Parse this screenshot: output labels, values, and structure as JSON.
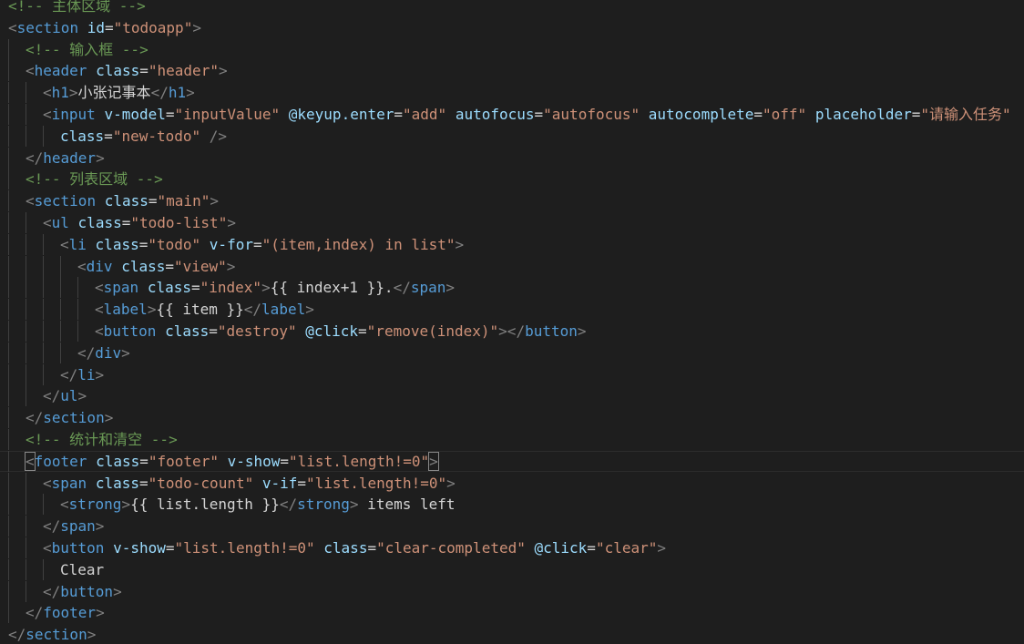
{
  "editor": {
    "theme": {
      "background": "#1e1e1e",
      "comment": "#6a9955",
      "tag": "#569cd6",
      "attribute": "#9cdcfe",
      "string": "#ce9178",
      "text": "#d4d4d4",
      "bracket": "#808080"
    },
    "current_line": 21,
    "lines": [
      {
        "indent": 0,
        "tokens": [
          [
            "cmt",
            "<!-- 主体区域 -->"
          ]
        ]
      },
      {
        "indent": 0,
        "tokens": [
          [
            "br",
            "<"
          ],
          [
            "tag",
            "section"
          ],
          [
            "txt",
            " "
          ],
          [
            "attr",
            "id"
          ],
          [
            "eq",
            "="
          ],
          [
            "str",
            "\"todoapp\""
          ],
          [
            "br",
            ">"
          ]
        ]
      },
      {
        "indent": 1,
        "tokens": [
          [
            "cmt",
            "<!-- 输入框 -->"
          ]
        ]
      },
      {
        "indent": 1,
        "tokens": [
          [
            "br",
            "<"
          ],
          [
            "tag",
            "header"
          ],
          [
            "txt",
            " "
          ],
          [
            "attr",
            "class"
          ],
          [
            "eq",
            "="
          ],
          [
            "str",
            "\"header\""
          ],
          [
            "br",
            ">"
          ]
        ]
      },
      {
        "indent": 2,
        "tokens": [
          [
            "br",
            "<"
          ],
          [
            "tag",
            "h1"
          ],
          [
            "br",
            ">"
          ],
          [
            "txt",
            "小张记事本"
          ],
          [
            "br",
            "</"
          ],
          [
            "tag",
            "h1"
          ],
          [
            "br",
            ">"
          ]
        ]
      },
      {
        "indent": 2,
        "tokens": [
          [
            "br",
            "<"
          ],
          [
            "tag",
            "input"
          ],
          [
            "txt",
            " "
          ],
          [
            "attr",
            "v-model"
          ],
          [
            "eq",
            "="
          ],
          [
            "str",
            "\"inputValue\""
          ],
          [
            "txt",
            " "
          ],
          [
            "attr",
            "@keyup.enter"
          ],
          [
            "eq",
            "="
          ],
          [
            "str",
            "\"add\""
          ],
          [
            "txt",
            " "
          ],
          [
            "attr",
            "autofocus"
          ],
          [
            "eq",
            "="
          ],
          [
            "str",
            "\"autofocus\""
          ],
          [
            "txt",
            " "
          ],
          [
            "attr",
            "autocomplete"
          ],
          [
            "eq",
            "="
          ],
          [
            "str",
            "\"off\""
          ],
          [
            "txt",
            " "
          ],
          [
            "attr",
            "placeholder"
          ],
          [
            "eq",
            "="
          ],
          [
            "str",
            "\"请输入任务\""
          ]
        ]
      },
      {
        "indent": 3,
        "tokens": [
          [
            "attr",
            "class"
          ],
          [
            "eq",
            "="
          ],
          [
            "str",
            "\"new-todo\""
          ],
          [
            "txt",
            " "
          ],
          [
            "br",
            "/>"
          ]
        ]
      },
      {
        "indent": 1,
        "tokens": [
          [
            "br",
            "</"
          ],
          [
            "tag",
            "header"
          ],
          [
            "br",
            ">"
          ]
        ]
      },
      {
        "indent": 1,
        "tokens": [
          [
            "cmt",
            "<!-- 列表区域 -->"
          ]
        ]
      },
      {
        "indent": 1,
        "tokens": [
          [
            "br",
            "<"
          ],
          [
            "tag",
            "section"
          ],
          [
            "txt",
            " "
          ],
          [
            "attr",
            "class"
          ],
          [
            "eq",
            "="
          ],
          [
            "str",
            "\"main\""
          ],
          [
            "br",
            ">"
          ]
        ]
      },
      {
        "indent": 2,
        "tokens": [
          [
            "br",
            "<"
          ],
          [
            "tag",
            "ul"
          ],
          [
            "txt",
            " "
          ],
          [
            "attr",
            "class"
          ],
          [
            "eq",
            "="
          ],
          [
            "str",
            "\"todo-list\""
          ],
          [
            "br",
            ">"
          ]
        ]
      },
      {
        "indent": 3,
        "tokens": [
          [
            "br",
            "<"
          ],
          [
            "tag",
            "li"
          ],
          [
            "txt",
            " "
          ],
          [
            "attr",
            "class"
          ],
          [
            "eq",
            "="
          ],
          [
            "str",
            "\"todo\""
          ],
          [
            "txt",
            " "
          ],
          [
            "attr",
            "v-for"
          ],
          [
            "eq",
            "="
          ],
          [
            "str",
            "\"(item,index) in list\""
          ],
          [
            "br",
            ">"
          ]
        ]
      },
      {
        "indent": 4,
        "tokens": [
          [
            "br",
            "<"
          ],
          [
            "tag",
            "div"
          ],
          [
            "txt",
            " "
          ],
          [
            "attr",
            "class"
          ],
          [
            "eq",
            "="
          ],
          [
            "str",
            "\"view\""
          ],
          [
            "br",
            ">"
          ]
        ]
      },
      {
        "indent": 5,
        "tokens": [
          [
            "br",
            "<"
          ],
          [
            "tag",
            "span"
          ],
          [
            "txt",
            " "
          ],
          [
            "attr",
            "class"
          ],
          [
            "eq",
            "="
          ],
          [
            "str",
            "\"index\""
          ],
          [
            "br",
            ">"
          ],
          [
            "txt",
            "{{ index+1 }}."
          ],
          [
            "br",
            "</"
          ],
          [
            "tag",
            "span"
          ],
          [
            "br",
            ">"
          ]
        ]
      },
      {
        "indent": 5,
        "tokens": [
          [
            "br",
            "<"
          ],
          [
            "tag",
            "label"
          ],
          [
            "br",
            ">"
          ],
          [
            "txt",
            "{{ item }}"
          ],
          [
            "br",
            "</"
          ],
          [
            "tag",
            "label"
          ],
          [
            "br",
            ">"
          ]
        ]
      },
      {
        "indent": 5,
        "tokens": [
          [
            "br",
            "<"
          ],
          [
            "tag",
            "button"
          ],
          [
            "txt",
            " "
          ],
          [
            "attr",
            "class"
          ],
          [
            "eq",
            "="
          ],
          [
            "str",
            "\"destroy\""
          ],
          [
            "txt",
            " "
          ],
          [
            "attr",
            "@click"
          ],
          [
            "eq",
            "="
          ],
          [
            "str",
            "\"remove(index)\""
          ],
          [
            "br",
            "></"
          ],
          [
            "tag",
            "button"
          ],
          [
            "br",
            ">"
          ]
        ]
      },
      {
        "indent": 4,
        "tokens": [
          [
            "br",
            "</"
          ],
          [
            "tag",
            "div"
          ],
          [
            "br",
            ">"
          ]
        ]
      },
      {
        "indent": 3,
        "tokens": [
          [
            "br",
            "</"
          ],
          [
            "tag",
            "li"
          ],
          [
            "br",
            ">"
          ]
        ]
      },
      {
        "indent": 2,
        "tokens": [
          [
            "br",
            "</"
          ],
          [
            "tag",
            "ul"
          ],
          [
            "br",
            ">"
          ]
        ]
      },
      {
        "indent": 1,
        "tokens": [
          [
            "br",
            "</"
          ],
          [
            "tag",
            "section"
          ],
          [
            "br",
            ">"
          ]
        ]
      },
      {
        "indent": 1,
        "tokens": [
          [
            "cmt",
            "<!-- 统计和清空 -->"
          ]
        ]
      },
      {
        "indent": 1,
        "tokens": [
          [
            "match",
            "<"
          ],
          [
            "tag",
            "footer"
          ],
          [
            "txt",
            " "
          ],
          [
            "attr",
            "class"
          ],
          [
            "eq",
            "="
          ],
          [
            "str",
            "\"footer\""
          ],
          [
            "txt",
            " "
          ],
          [
            "attr",
            "v-show"
          ],
          [
            "eq",
            "="
          ],
          [
            "str",
            "\"list.length!=0\""
          ],
          [
            "match",
            ">"
          ]
        ]
      },
      {
        "indent": 2,
        "tokens": [
          [
            "br",
            "<"
          ],
          [
            "tag",
            "span"
          ],
          [
            "txt",
            " "
          ],
          [
            "attr",
            "class"
          ],
          [
            "eq",
            "="
          ],
          [
            "str",
            "\"todo-count\""
          ],
          [
            "txt",
            " "
          ],
          [
            "attr",
            "v-if"
          ],
          [
            "eq",
            "="
          ],
          [
            "str",
            "\"list.length!=0\""
          ],
          [
            "br",
            ">"
          ]
        ]
      },
      {
        "indent": 3,
        "tokens": [
          [
            "br",
            "<"
          ],
          [
            "tag",
            "strong"
          ],
          [
            "br",
            ">"
          ],
          [
            "txt",
            "{{ list.length }}"
          ],
          [
            "br",
            "</"
          ],
          [
            "tag",
            "strong"
          ],
          [
            "br",
            ">"
          ],
          [
            "txt",
            " items left"
          ]
        ]
      },
      {
        "indent": 2,
        "tokens": [
          [
            "br",
            "</"
          ],
          [
            "tag",
            "span"
          ],
          [
            "br",
            ">"
          ]
        ]
      },
      {
        "indent": 2,
        "tokens": [
          [
            "br",
            "<"
          ],
          [
            "tag",
            "button"
          ],
          [
            "txt",
            " "
          ],
          [
            "attr",
            "v-show"
          ],
          [
            "eq",
            "="
          ],
          [
            "str",
            "\"list.length!=0\""
          ],
          [
            "txt",
            " "
          ],
          [
            "attr",
            "class"
          ],
          [
            "eq",
            "="
          ],
          [
            "str",
            "\"clear-completed\""
          ],
          [
            "txt",
            " "
          ],
          [
            "attr",
            "@click"
          ],
          [
            "eq",
            "="
          ],
          [
            "str",
            "\"clear\""
          ],
          [
            "br",
            ">"
          ]
        ]
      },
      {
        "indent": 3,
        "tokens": [
          [
            "txt",
            "Clear"
          ]
        ]
      },
      {
        "indent": 2,
        "tokens": [
          [
            "br",
            "</"
          ],
          [
            "tag",
            "button"
          ],
          [
            "br",
            ">"
          ]
        ]
      },
      {
        "indent": 1,
        "tokens": [
          [
            "br",
            "</"
          ],
          [
            "tag",
            "footer"
          ],
          [
            "br",
            ">"
          ]
        ]
      },
      {
        "indent": 0,
        "tokens": [
          [
            "br",
            "</"
          ],
          [
            "tag",
            "section"
          ],
          [
            "br",
            ">"
          ]
        ]
      }
    ]
  }
}
